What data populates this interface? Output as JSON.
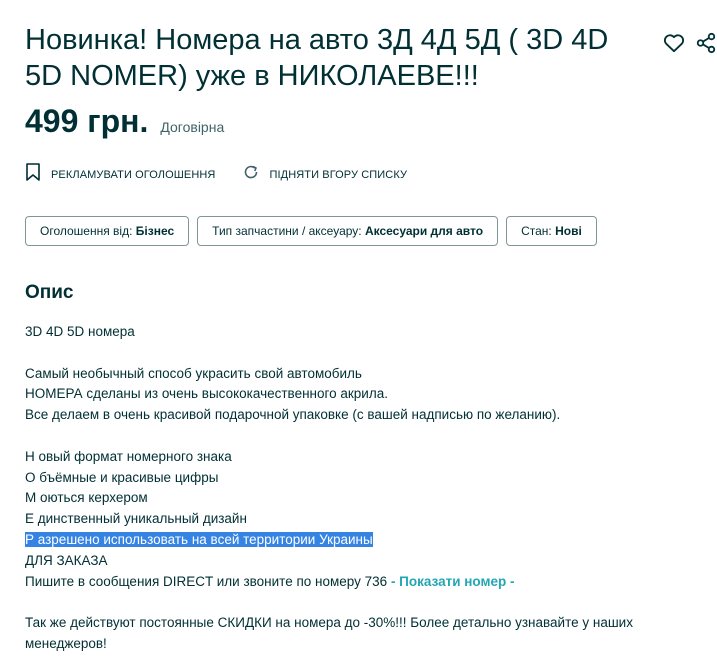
{
  "listing": {
    "title": "Новинка! Номера на авто 3Д 4Д 5Д ( 3D 4D 5D NOMER) уже в НИКОЛАЕВЕ!!!",
    "price": "499 грн.",
    "negotiable": "Договірна",
    "icons": {
      "favorite": "heart-icon",
      "share": "share-icon",
      "promote": "bookmark-icon",
      "refresh": "refresh-icon"
    }
  },
  "promo": {
    "advertise_label": "РЕКЛАМУВАТИ ОГОЛОШЕННЯ",
    "raise_label": "ПІДНЯТИ ВГОРУ СПИСКУ"
  },
  "tags": [
    {
      "key": "Оголошення від: ",
      "value": "Бізнес"
    },
    {
      "key": "Тип запчастини / аксеуару: ",
      "value": "Аксесуари для авто"
    },
    {
      "key": "Стан: ",
      "value": "Нові"
    }
  ],
  "description": {
    "heading": "Опис",
    "lines": [
      "3D 4D 5D номера",
      "",
      "Самый необычный способ украсить свой автомобиль",
      "НОМЕРА сделаны из очень высококачественного акрила.",
      "Все делаем в очень красивой подарочной упаковке (с вашей надписью по желанию).",
      "",
      "Н овый формат номерного знака",
      "О бъёмные и красивые цифры",
      "М оються керхером",
      "Е динственный уникальный дизайн",
      "Р азрешено использовать на всей территории Украины",
      "ДЛЯ ЗАКАЗА",
      "Пишите в сообщения DIRECT или звоните по номеру 736 ",
      "",
      "Так же действуют постоянные СКИДКИ на номера до -30%!!! Более детально узнавайте у наших",
      "менеджеров!"
    ],
    "show_phone": "- Показати номер -"
  },
  "colors": {
    "text": "#002f34",
    "link": "#23a6b3",
    "selection": "#3584e4",
    "border": "#7f9799"
  }
}
